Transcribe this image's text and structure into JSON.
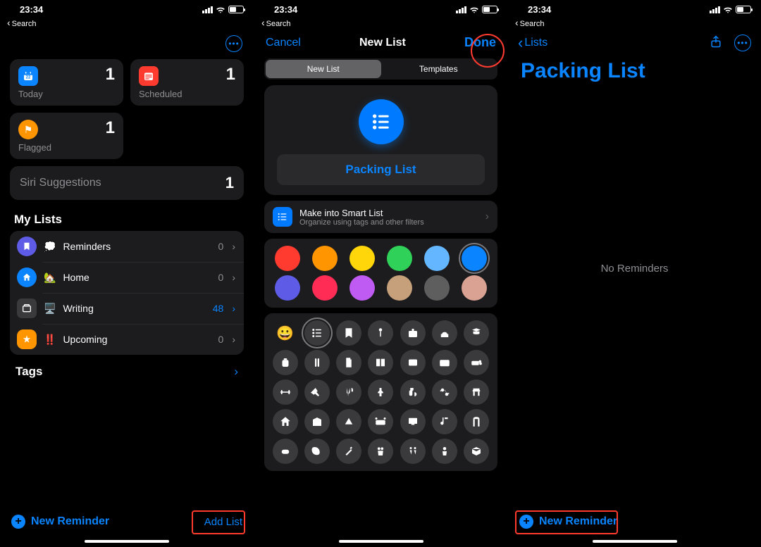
{
  "status": {
    "time": "23:34",
    "back_label": "Search"
  },
  "phone1": {
    "cards": {
      "today": {
        "label": "Today",
        "count": "1",
        "color": "#0a84ff",
        "glyph": "📅"
      },
      "scheduled": {
        "label": "Scheduled",
        "count": "1",
        "color": "#ff3b30",
        "glyph": "📅"
      },
      "flagged": {
        "label": "Flagged",
        "count": "1",
        "color": "#ff9500",
        "glyph": "⚑"
      }
    },
    "siri": {
      "label": "Siri Suggestions",
      "count": "1"
    },
    "my_lists_header": "My Lists",
    "lists": [
      {
        "name": "Reminders",
        "emoji": "💭",
        "count": "0",
        "dot": "#5e5ce6",
        "chev_blue": false
      },
      {
        "name": "Home",
        "emoji": "🏡",
        "count": "0",
        "dot": "#0a84ff",
        "chev_blue": false
      },
      {
        "name": "Writing",
        "emoji": "🖥️",
        "count": "48",
        "dot": "#3a3a3c",
        "chev_blue": true
      },
      {
        "name": "Upcoming",
        "emoji": "‼️",
        "count": "0",
        "dot": "#ff9500",
        "chev_blue": false
      }
    ],
    "tags_header": "Tags",
    "new_reminder": "New Reminder",
    "add_list": "Add List"
  },
  "phone2": {
    "cancel": "Cancel",
    "title": "New List",
    "done": "Done",
    "seg_a": "New List",
    "seg_b": "Templates",
    "list_name": "Packing List",
    "smart_title": "Make into Smart List",
    "smart_sub": "Organize using tags and other filters",
    "colors": [
      "#ff3b30",
      "#ff9500",
      "#ffd60a",
      "#30d158",
      "#64b7ff",
      "#0a84ff",
      "#5e5ce6",
      "#ff2d55",
      "#bf5af2",
      "#c6a07a",
      "#5e5e5e",
      "#d9a293"
    ],
    "selected_color_index": 5,
    "selected_icon_index": 1
  },
  "phone3": {
    "back": "Lists",
    "title": "Packing List",
    "empty": "No Reminders",
    "new_reminder": "New Reminder"
  }
}
